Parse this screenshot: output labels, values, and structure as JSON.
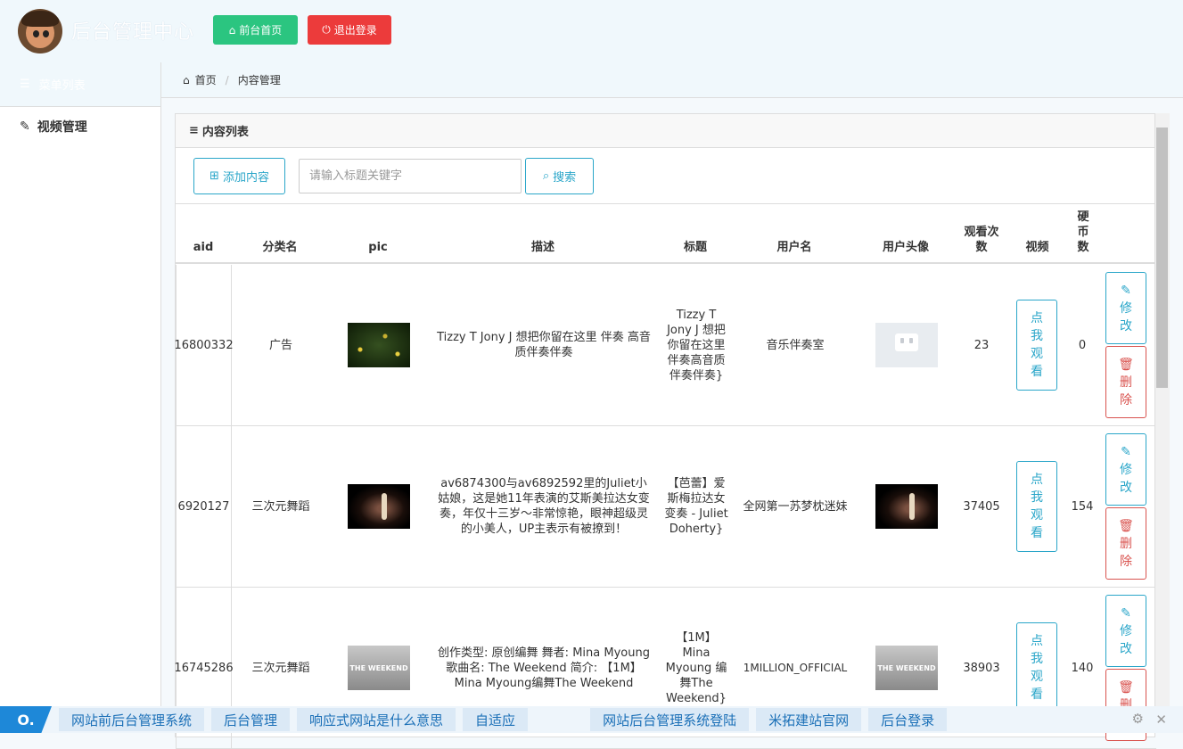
{
  "header": {
    "app_title": "后台管理中心",
    "home_button": "前台首页",
    "logout_button": "退出登录"
  },
  "sidebar": {
    "menu_title": "菜单列表",
    "items": [
      {
        "label": "视频管理"
      }
    ]
  },
  "breadcrumb": {
    "home": "首页",
    "current": "内容管理"
  },
  "panel": {
    "title": "内容列表",
    "add_button": "添加内容",
    "search_placeholder": "请输入标题关键字",
    "search_button": "搜索"
  },
  "table": {
    "headers": {
      "aid": "aid",
      "category": "分类名",
      "pic": "pic",
      "description": "描述",
      "title": "标题",
      "username": "用户名",
      "avatar": "用户头像",
      "views": "观看次数",
      "video": "视频",
      "coins": "硬币数"
    },
    "watch_label": "点我观看",
    "edit_label": "修改",
    "delete_label": "删除",
    "rows": [
      {
        "aid": "16800332",
        "category": "广告",
        "description": "Tizzy T Jony J 想把你留在这里 伴奏 高音质伴奏伴奏",
        "title": "Tizzy T Jony J 想把你留在这里 伴奏高音质伴奏伴奏}",
        "username": "音乐伴奏室",
        "views": "23",
        "coins": "0"
      },
      {
        "aid": "6920127",
        "category": "三次元舞蹈",
        "description": "av6874300与av6892592里的Juliet小姑娘，这是她11年表演的艾斯美拉达女变奏，年仅十三岁～非常惊艳，眼神超级灵的小美人，UP主表示有被撩到！",
        "title": "【芭蕾】爱斯梅拉达女变奏 - Juliet Doherty}",
        "username": "全网第一苏梦枕迷妹",
        "views": "37405",
        "coins": "154"
      },
      {
        "aid": "16745286",
        "category": "三次元舞蹈",
        "description": "创作类型: 原创编舞 舞者: Mina Myoung 歌曲名: The Weekend 简介: 【1M】Mina Myoung编舞The Weekend",
        "title": "【1M】Mina Myoung 编舞The Weekend}",
        "username": "1MILLION_OFFICIAL",
        "views": "38903",
        "coins": "140",
        "thumb_text": "THE WEEKEND"
      }
    ]
  },
  "adbar": {
    "logo": "O.",
    "links": [
      "网站前后台管理系统",
      "后台管理",
      "响应式网站是什么意思",
      "自适应",
      "网站后台管理系统登陆",
      "米拓建站官网",
      "后台登录"
    ]
  },
  "colors": {
    "green": "#2bc580",
    "red": "#ec3b3b",
    "accent": "#2aa6c9"
  }
}
